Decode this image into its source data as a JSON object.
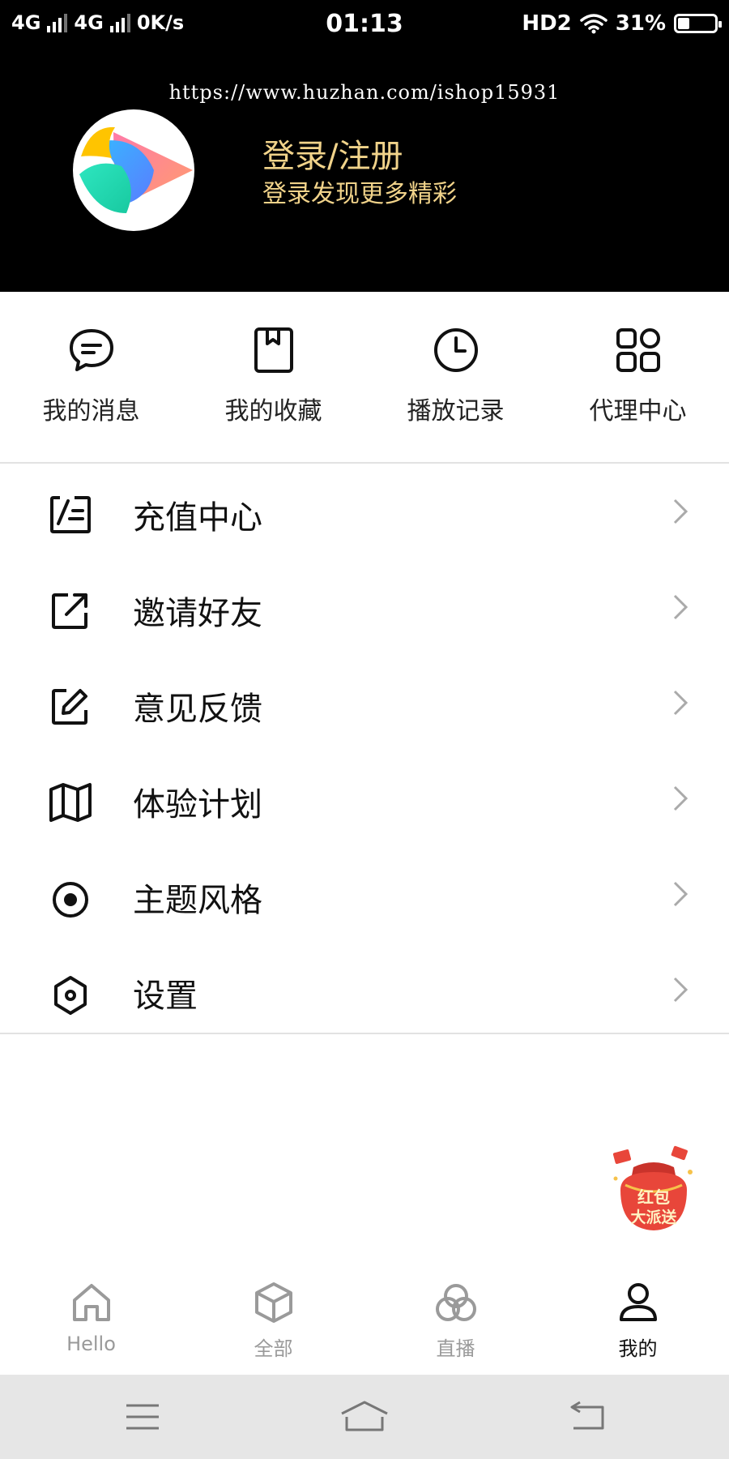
{
  "status_bar": {
    "network1": "4G",
    "network2": "4G",
    "speed": "0K/s",
    "time": "01:13",
    "hd": "HD2",
    "battery_percent": "31%",
    "battery_level": 0.31
  },
  "header": {
    "watermark": "https://www.huzhan.com/ishop15931",
    "login_title": "登录/注册",
    "login_subtitle": "登录发现更多精彩"
  },
  "quick_actions": [
    {
      "label": "我的消息",
      "icon": "message-icon"
    },
    {
      "label": "我的收藏",
      "icon": "bookmark-icon"
    },
    {
      "label": "播放记录",
      "icon": "clock-icon"
    },
    {
      "label": "代理中心",
      "icon": "grid-icon"
    }
  ],
  "menu": [
    {
      "label": "充值中心",
      "icon": "recharge-icon"
    },
    {
      "label": "邀请好友",
      "icon": "share-icon"
    },
    {
      "label": "意见反馈",
      "icon": "edit-icon"
    },
    {
      "label": "体验计划",
      "icon": "map-icon"
    },
    {
      "label": "主题风格",
      "icon": "radio-icon"
    },
    {
      "label": "设置",
      "icon": "settings-icon"
    }
  ],
  "red_packet": {
    "line1": "红包",
    "line2": "大派送"
  },
  "tabs": [
    {
      "label": "Hello",
      "icon": "home-icon",
      "active": false
    },
    {
      "label": "全部",
      "icon": "box-icon",
      "active": false
    },
    {
      "label": "直播",
      "icon": "circles-icon",
      "active": false
    },
    {
      "label": "我的",
      "icon": "user-icon",
      "active": true
    }
  ],
  "colors": {
    "header_bg": "#000000",
    "login_text": "#f1d38a",
    "tab_inactive": "#9a9a9a",
    "tab_active": "#111111",
    "red_packet": "#e8463a"
  }
}
